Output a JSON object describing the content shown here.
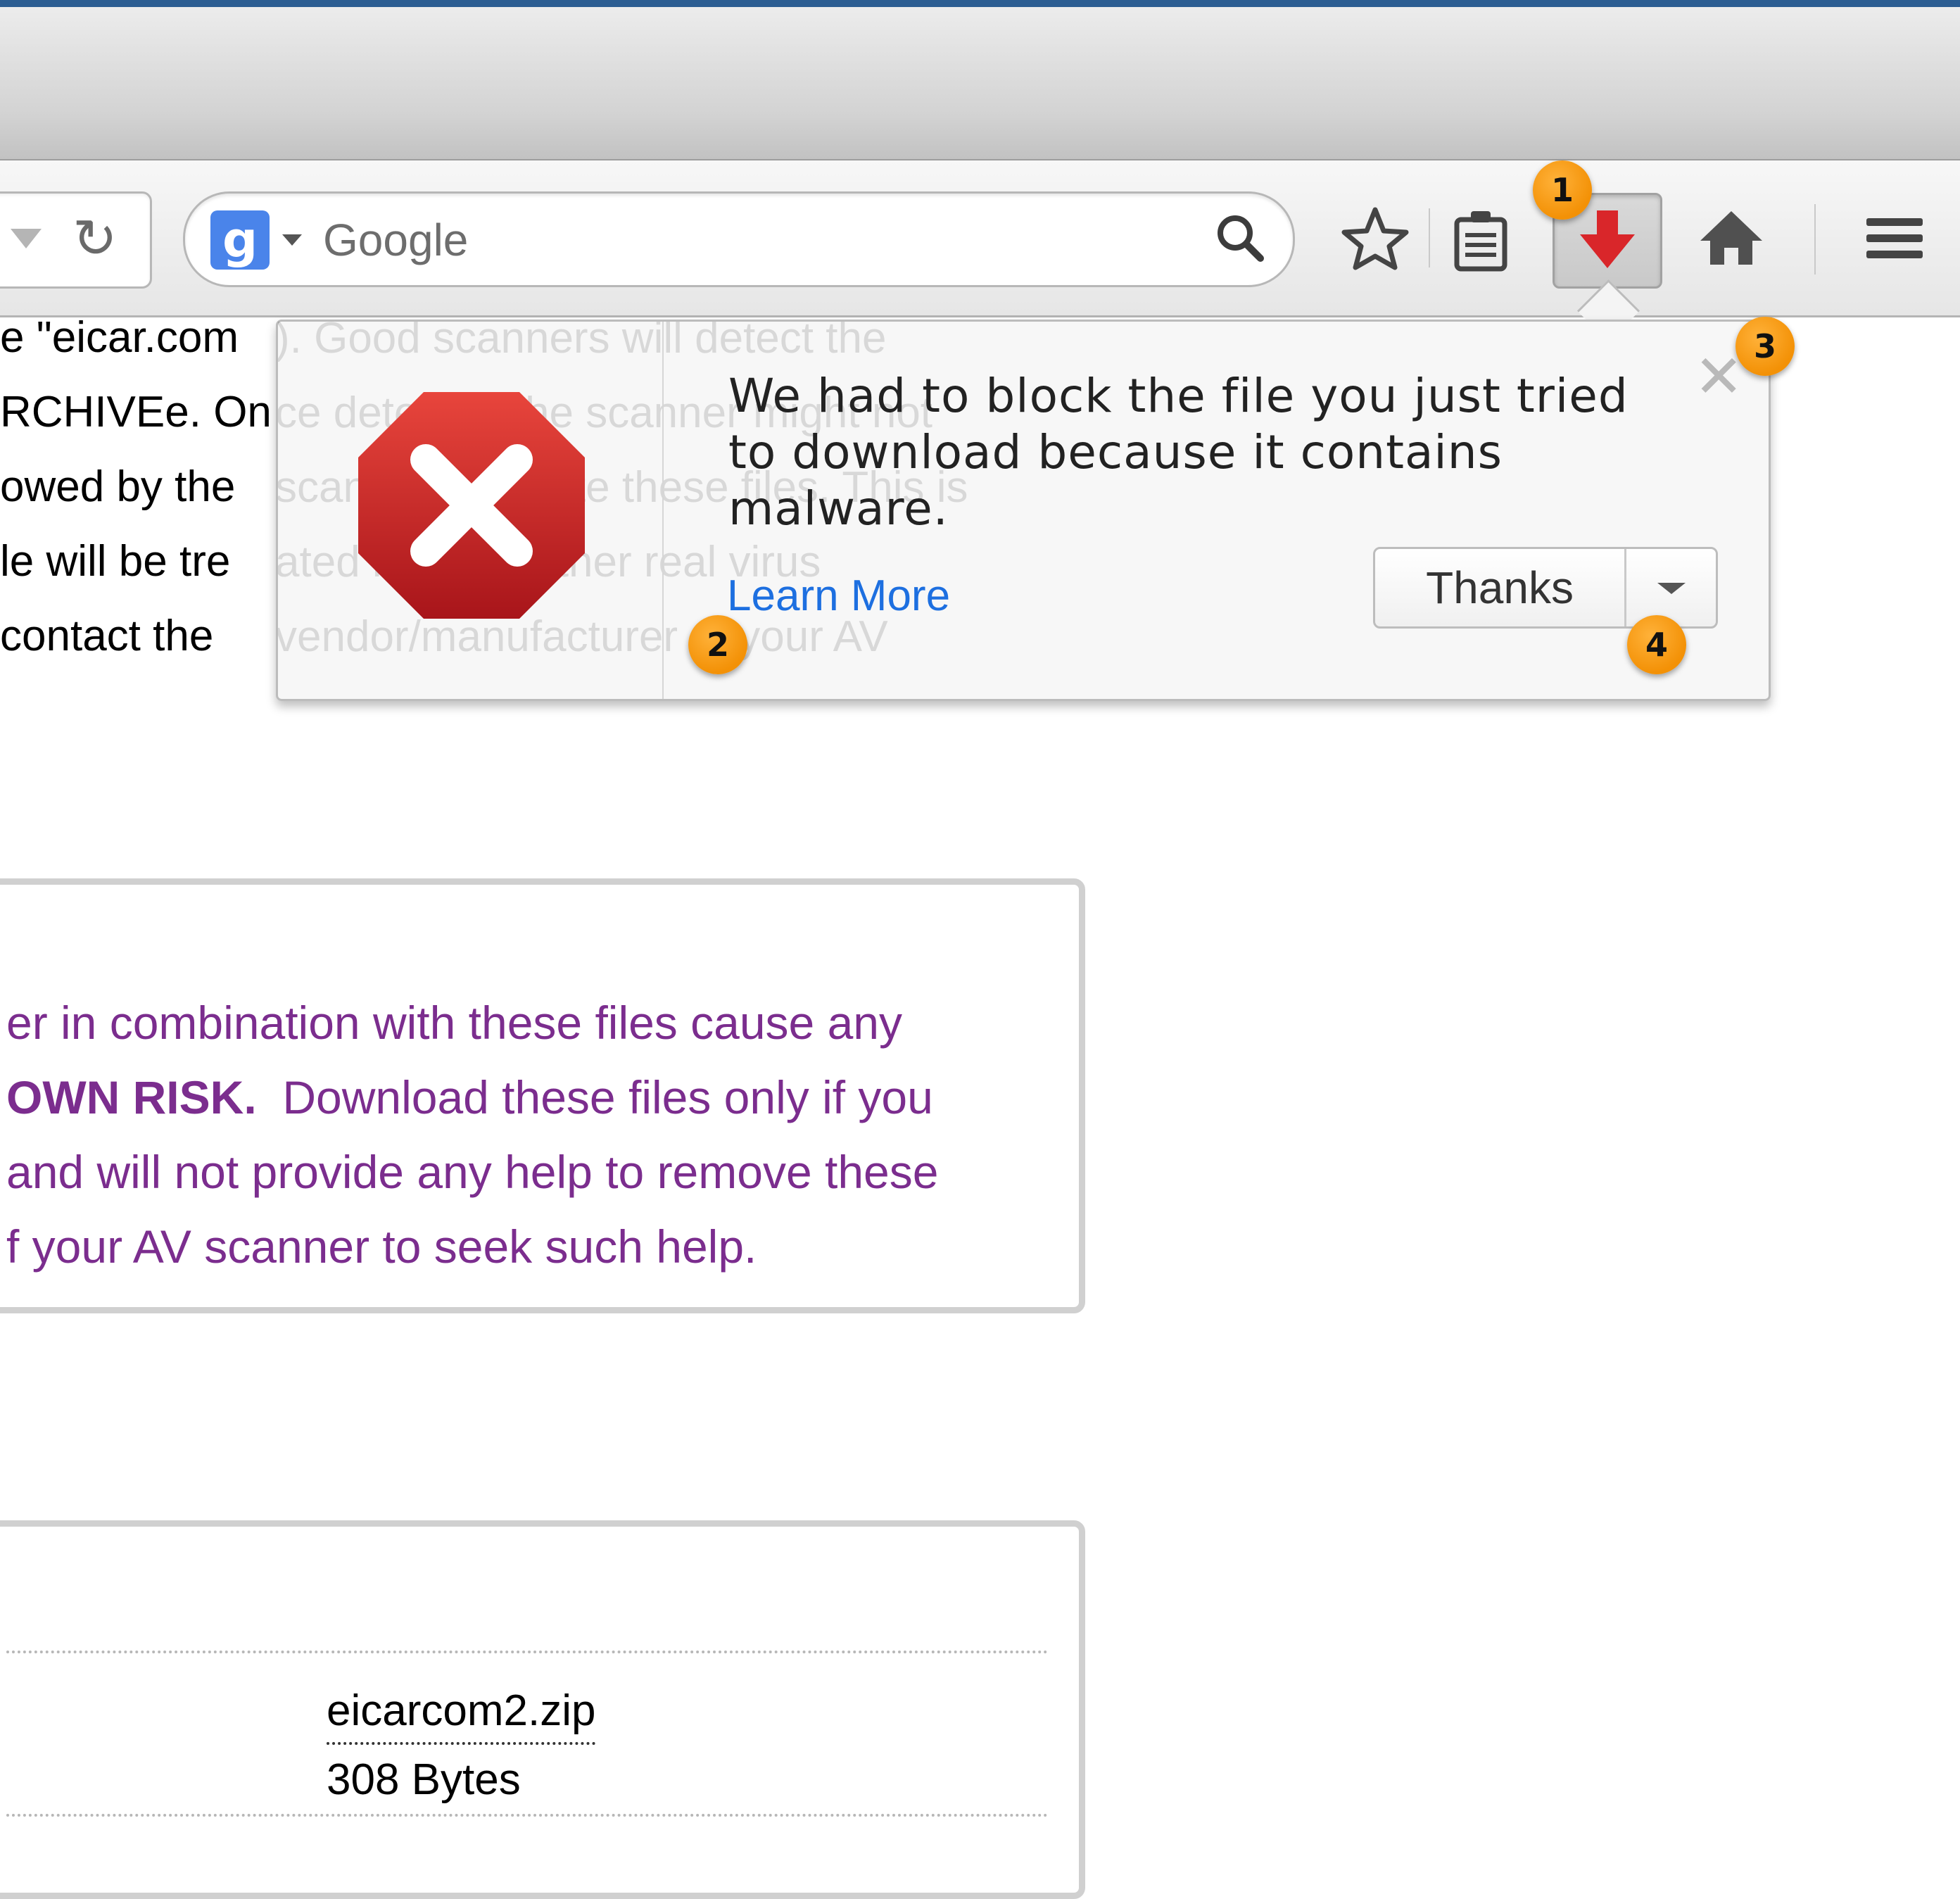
{
  "toolbar": {
    "search_placeholder": "Google",
    "search_engine_icon": "google-g-icon",
    "icons": [
      "dropmarker-icon",
      "reload-icon",
      "search-icon",
      "bookmark-star-icon",
      "reading-list-icon",
      "download-arrow-icon",
      "home-icon",
      "menu-icon"
    ]
  },
  "page": {
    "intro_lines": [
      "e \"eicar.com",
      "RCHIVEe. On",
      "owed by the",
      "le will be tre",
      " contact the"
    ],
    "faded_lines": [
      "). Good scanners will detect the",
      "ce detected the scanner might not",
      "scanner to delete these files. This is",
      "ated like any other real virus",
      "vendor/manufacturer of your AV"
    ],
    "warning": {
      "line1": "er in combination with these files cause any",
      "line2_bold": "OWN RISK.",
      "line2_rest": "  Download these files only if you",
      "line3": " and will not provide any help to remove these",
      "line4": "f your AV scanner to seek such help."
    },
    "file": {
      "name": "eicarcom2.zip",
      "size": "308 Bytes"
    }
  },
  "panel": {
    "message": "We had to block the file you just tried to download because it contains malware.",
    "learn_more": "Learn More",
    "primary_button": "Thanks",
    "close_glyph": "✕"
  },
  "callouts": [
    "1",
    "2",
    "3",
    "4"
  ],
  "colors": {
    "accent_bar": "#2c5d92",
    "callout": "#f39106",
    "link": "#1d6fe0",
    "warning_text": "#7b2d8e",
    "download_arrow": "#d9262a"
  }
}
